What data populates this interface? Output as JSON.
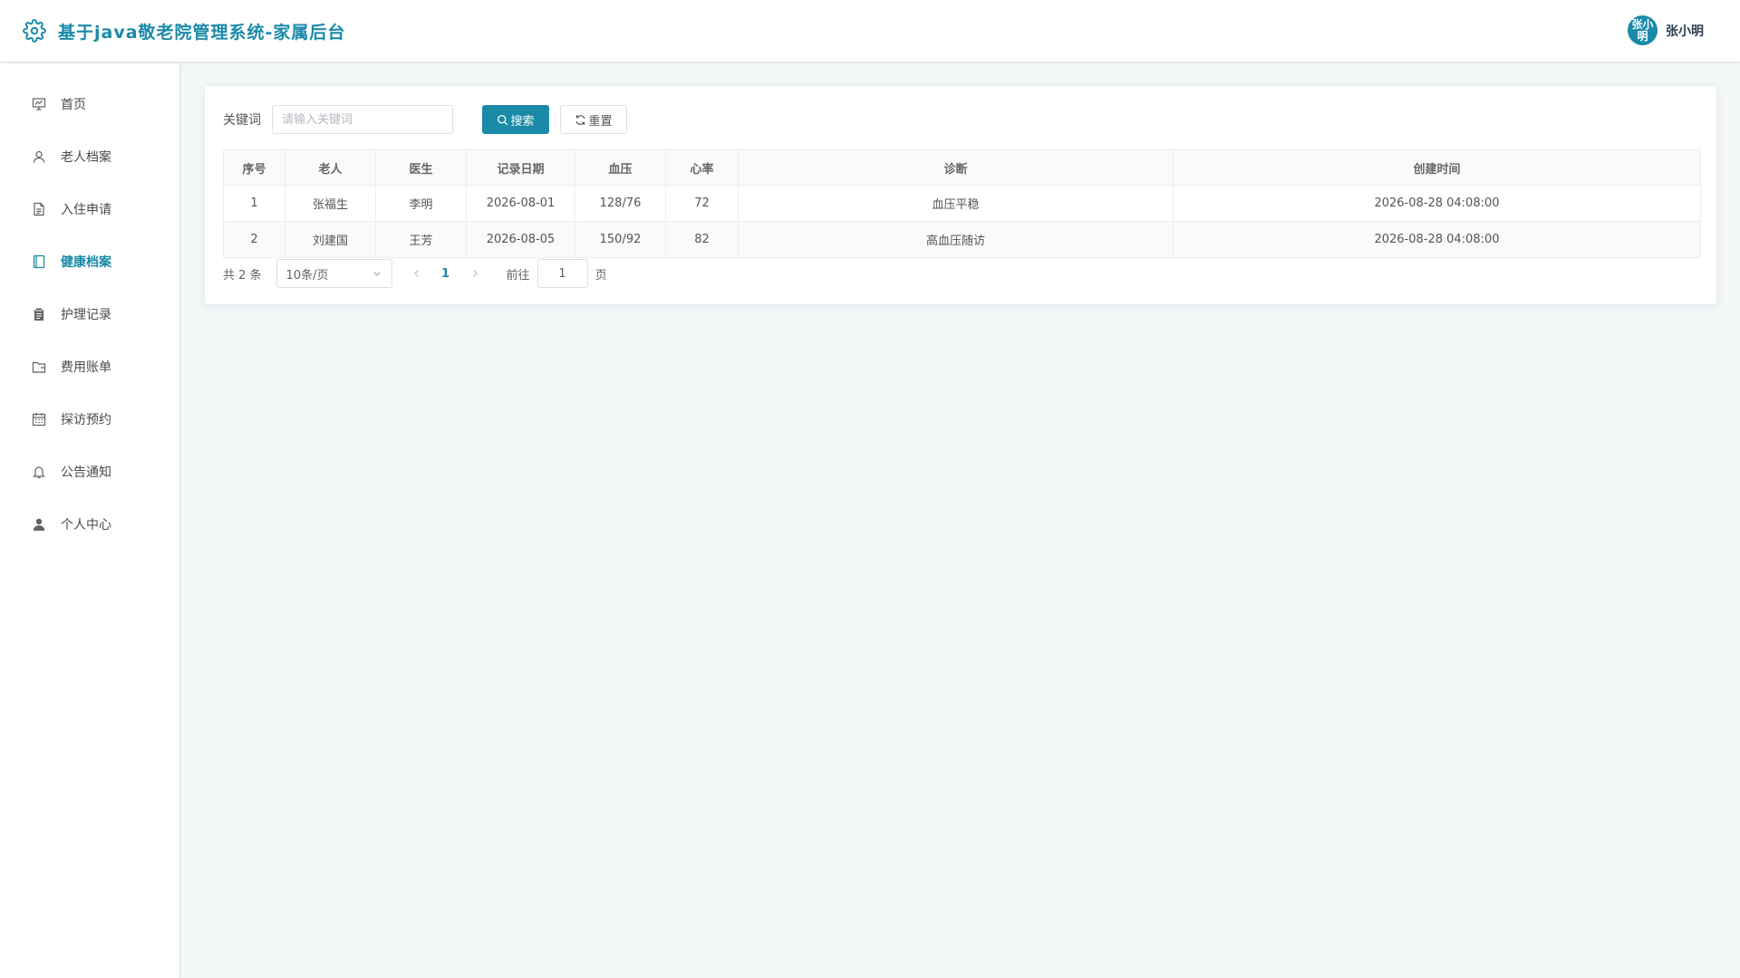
{
  "header": {
    "title": "基于java敬老院管理系统-家属后台",
    "avatar_text": "张小明",
    "username": "张小明"
  },
  "theme": {
    "accent": "#1a8aa8"
  },
  "sidebar": {
    "items": [
      {
        "label": "首页",
        "icon": "presentation-chart-icon"
      },
      {
        "label": "老人档案",
        "icon": "user-icon"
      },
      {
        "label": "入住申请",
        "icon": "document-icon"
      },
      {
        "label": "健康档案",
        "icon": "notebook-icon",
        "active": true
      },
      {
        "label": "护理记录",
        "icon": "clipboard-icon"
      },
      {
        "label": "费用账单",
        "icon": "wallet-icon"
      },
      {
        "label": "探访预约",
        "icon": "calendar-icon"
      },
      {
        "label": "公告通知",
        "icon": "bell-icon"
      },
      {
        "label": "个人中心",
        "icon": "user-filled-icon"
      }
    ]
  },
  "search": {
    "label": "关键词",
    "placeholder": "请输入关键词",
    "value": "",
    "search_button": "搜索",
    "reset_button": "重置"
  },
  "table": {
    "columns": [
      "序号",
      "老人",
      "医生",
      "记录日期",
      "血压",
      "心率",
      "诊断",
      "创建时间"
    ],
    "rows": [
      [
        "1",
        "张福生",
        "李明",
        "2026-08-01",
        "128/76",
        "72",
        "血压平稳",
        "2026-08-28 04:08:00"
      ],
      [
        "2",
        "刘建国",
        "王芳",
        "2026-08-05",
        "150/92",
        "82",
        "高血压随访",
        "2026-08-28 04:08:00"
      ]
    ]
  },
  "pagination": {
    "total_text": "共 2 条",
    "page_size": "10条/页",
    "current_page": "1",
    "goto_label": "前往",
    "goto_value": "1",
    "page_unit": "页"
  }
}
